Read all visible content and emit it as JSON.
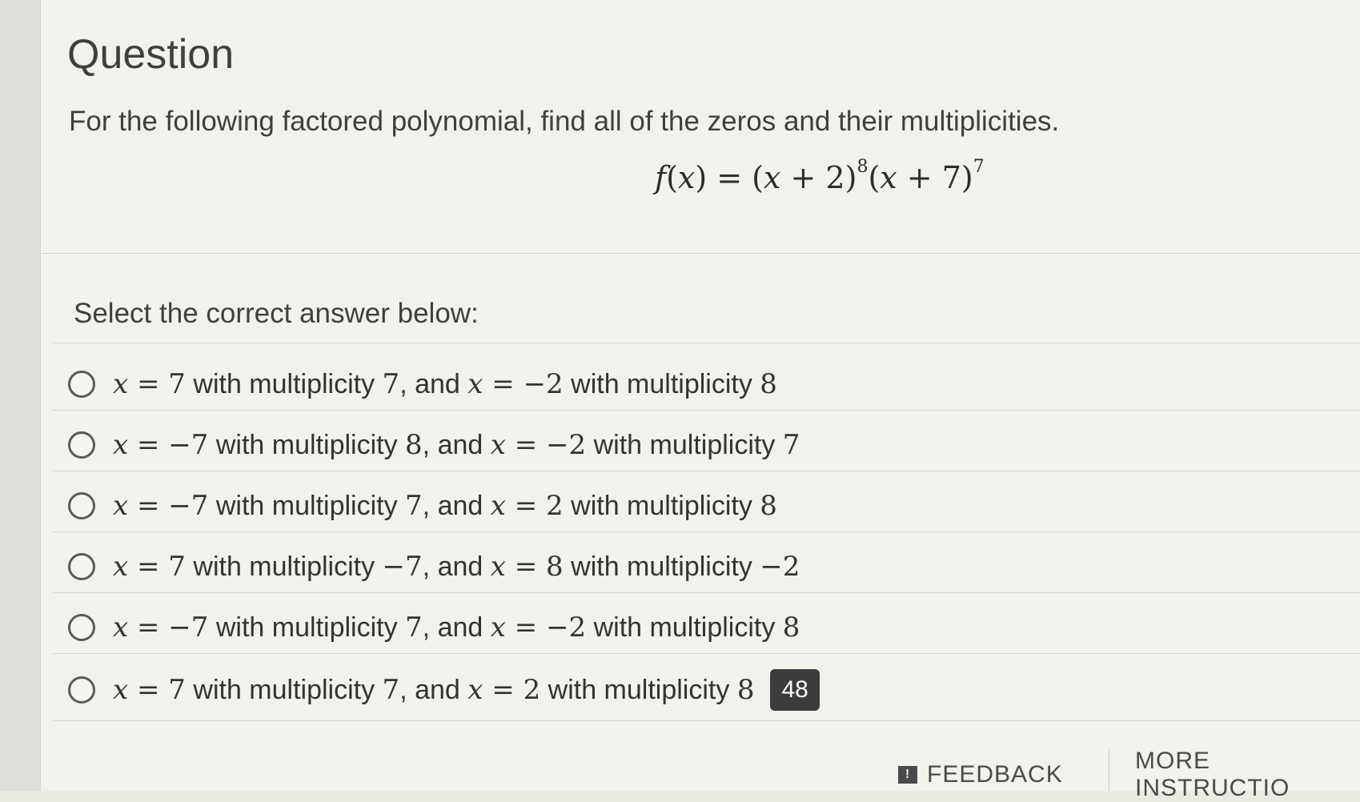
{
  "question": {
    "title": "Question",
    "prompt": "For the following factored polynomial, find all of the zeros and their multiplicities.",
    "formula": {
      "fx": "f",
      "x": "x",
      "lhs_open": "(",
      "lhs_close": ") = (",
      "plus2": " + 2)",
      "exp1": "8",
      "open2": "(",
      "plus7": " + 7)",
      "exp2": "7"
    }
  },
  "answer_prompt": "Select the correct answer below:",
  "options": [
    {
      "z1": "7",
      "m1": "7",
      "z2": "−2",
      "m2": "8"
    },
    {
      "z1": "−7",
      "m1": "8",
      "z2": "−2",
      "m2": "7"
    },
    {
      "z1": "−7",
      "m1": "7",
      "z2": "2",
      "m2": "8"
    },
    {
      "z1": "7",
      "m1": "−7",
      "z2": "8",
      "m2": "−2"
    },
    {
      "z1": "−7",
      "m1": "7",
      "z2": "−2",
      "m2": "8"
    },
    {
      "z1": "7",
      "m1": "7",
      "z2": "2",
      "m2": "8"
    }
  ],
  "labels": {
    "var": "x",
    "eq": " = ",
    "with_mult": " with multiplicity ",
    "and": ", and "
  },
  "badge": "48",
  "footer": {
    "feedback": "FEEDBACK",
    "feedback_icon": "!",
    "more": "MORE INSTRUCTIO"
  }
}
